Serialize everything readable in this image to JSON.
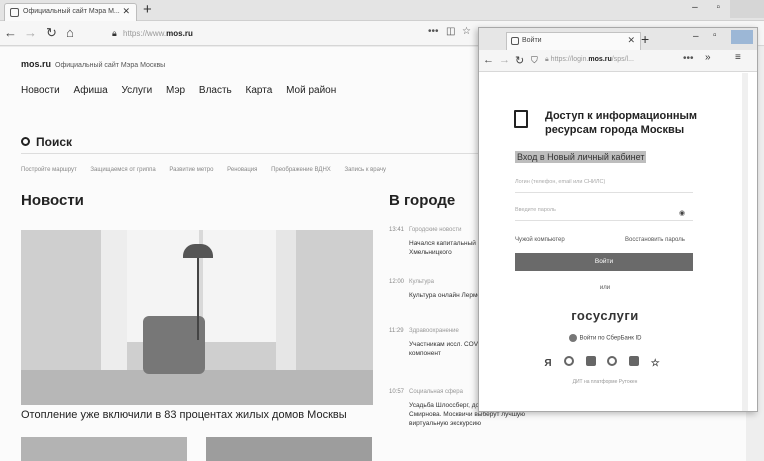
{
  "browser": {
    "tab_title": "Официальный сайт Мэра М...",
    "url_prefix": "https://www.",
    "url_domain": "mos.ru"
  },
  "site": {
    "brand": "mos.ru",
    "brand_sub": "Официальный сайт Мэра Москвы",
    "menu": [
      "Новости",
      "Афиша",
      "Услуги",
      "Мэр",
      "Власть",
      "Карта",
      "Мой район"
    ],
    "search_label": "Поиск",
    "quick_links": [
      "Постройте маршрут",
      "Защищаемся от гриппа",
      "Развитие метро",
      "Реновация",
      "Преображение ВДНХ",
      "Запись к врачу"
    ],
    "news_heading": "Новости",
    "city_heading": "В городе",
    "main_caption": "Отопление уже включили в 83 процентах жилых домов Москвы",
    "feed": [
      {
        "time": "13:41",
        "category": "Городские новости",
        "text": "Начался капитальный ремонт Богдана Хмельницкого"
      },
      {
        "time": "12:00",
        "category": "Культура",
        "text": "Культура онлайн Лермонтова в ..."
      },
      {
        "time": "11:29",
        "category": "Здравоохранение",
        "text": "Участникам иссл. COVID-19 начал... компонент"
      },
      {
        "time": "10:57",
        "category": "Социальная сфера",
        "text": "Усадьба Шлоссберг, дом-музей особняк Смирнова. Москвичи выберут лучшую виртуальную экскурсию"
      }
    ]
  },
  "popup": {
    "tab_title": "Войти",
    "url_prefix": "https://login.",
    "url_domain": "mos.ru",
    "url_suffix": "/sps/l...",
    "title": "Доступ к информационным ресурсам города Москвы",
    "subtitle": "Вход в Новый личный кабинет",
    "login_placeholder": "Логин (телефон, email или СНИЛС)",
    "password_placeholder": "Введите пароль",
    "alien_computer": "Чужой компьютер",
    "restore_password": "Восстановить пароль",
    "login_button": "Войти",
    "or_text": "или",
    "gosuslugi": "госуслуги",
    "sber_login": "Войти по СберБанк ID",
    "social": [
      "Я",
      "G",
      "▦",
      "ok",
      "✉",
      "☆"
    ],
    "footer": "ДИТ на платформе Рутокен"
  }
}
